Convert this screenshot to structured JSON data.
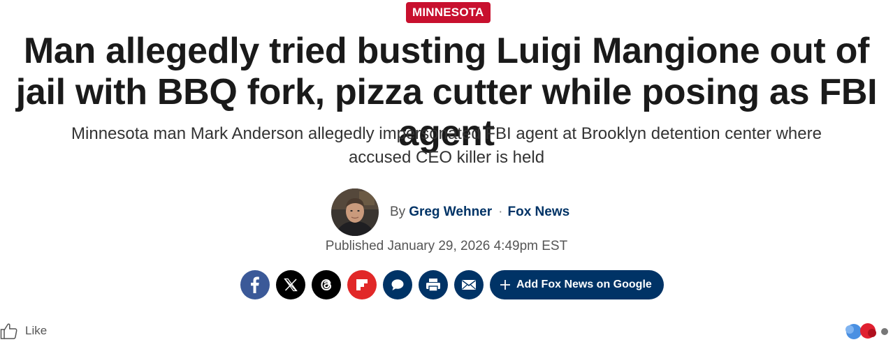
{
  "article": {
    "category": "MINNESOTA",
    "headline": "Man allegedly tried busting Luigi Mangione out of jail with BBQ fork, pizza cutter while posing as FBI agent",
    "subheadline": "Minnesota man Mark Anderson allegedly impersonated FBI agent at Brooklyn detention center where accused CEO killer is held",
    "byline": {
      "prefix": "By",
      "author": "Greg Wehner",
      "separator": "·",
      "outlet": "Fox News"
    },
    "published": "Published January 29, 2026 4:49pm EST"
  },
  "share": {
    "buttons": [
      {
        "name": "facebook",
        "icon": "facebook-icon",
        "color": "#3b5998"
      },
      {
        "name": "x",
        "icon": "x-icon",
        "color": "#000000"
      },
      {
        "name": "threads",
        "icon": "threads-icon",
        "color": "#000000"
      },
      {
        "name": "flipboard",
        "icon": "flipboard-icon",
        "color": "#e12828"
      },
      {
        "name": "comments",
        "icon": "comment-icon",
        "color": "#003366"
      },
      {
        "name": "print",
        "icon": "print-icon",
        "color": "#003366"
      },
      {
        "name": "email",
        "icon": "email-icon",
        "color": "#003366"
      }
    ],
    "add_google_label": "Add Fox News on Google"
  },
  "reactions": {
    "like_label": "Like"
  },
  "colors": {
    "category_bg": "#c8102e",
    "brand_navy": "#003366",
    "headline": "#1a1a1a"
  }
}
